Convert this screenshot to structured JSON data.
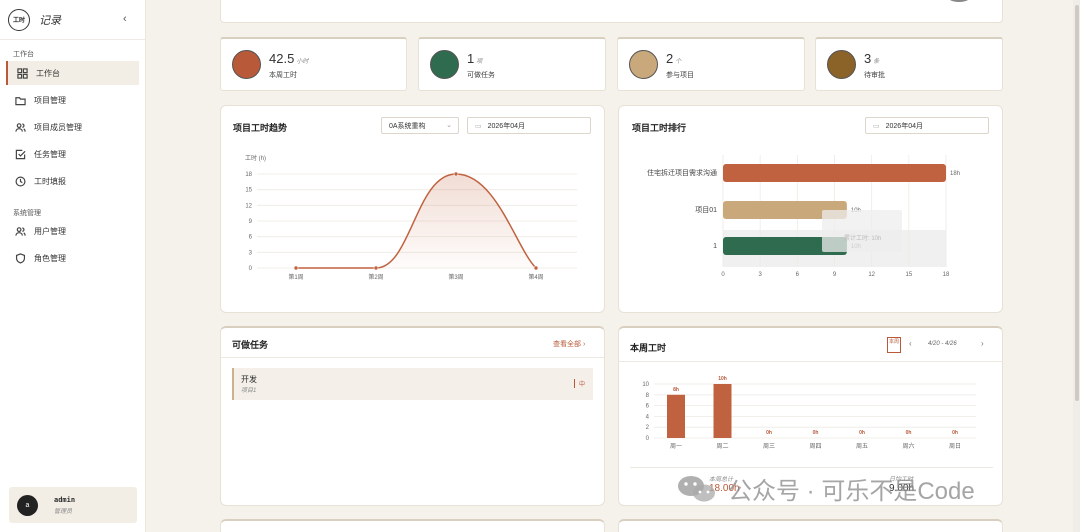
{
  "sidebar": {
    "logo_text": "工时",
    "title": "记录",
    "collapse_icon": "chevron-left-icon",
    "sections": [
      {
        "label": "工作台"
      },
      {
        "label": "系统管理"
      }
    ],
    "items": [
      {
        "label": "工作台",
        "icon": "grid-icon",
        "active": true
      },
      {
        "label": "项目管理",
        "icon": "folder-icon"
      },
      {
        "label": "项目成员管理",
        "icon": "users-icon"
      },
      {
        "label": "任务管理",
        "icon": "checkbox-icon"
      },
      {
        "label": "工时填报",
        "icon": "clock-icon"
      },
      {
        "label": "用户管理",
        "icon": "users-icon"
      },
      {
        "label": "角色管理",
        "icon": "shield-icon"
      }
    ],
    "user": {
      "avatar": "a",
      "name": "admin",
      "role": "管理员"
    }
  },
  "stats": [
    {
      "value": "42.5",
      "unit": "小时",
      "label": "本周工时",
      "color": "#b85a3a"
    },
    {
      "value": "1",
      "unit": "项",
      "label": "可做任务",
      "color": "#2f6b4f"
    },
    {
      "value": "2",
      "unit": "个",
      "label": "参与项目",
      "color": "#c9a87c"
    },
    {
      "value": "3",
      "unit": "条",
      "label": "待审批",
      "color": "#8b6228"
    }
  ],
  "trend": {
    "title": "项目工时趋势",
    "project_select": "0A系统重构",
    "month": "2026年04月",
    "chart_data": {
      "type": "line",
      "ylabel": "工时 (h)",
      "categories": [
        "第1周",
        "第2周",
        "第3周",
        "第4周"
      ],
      "values": [
        0,
        0,
        18,
        0
      ],
      "ylim": [
        0,
        18
      ],
      "yticks": [
        "0",
        "3",
        "6",
        "9",
        "12",
        "15",
        "18"
      ],
      "color": "#c0623f"
    }
  },
  "ranking": {
    "title": "项目工时排行",
    "month": "2026年04月",
    "tooltip": "累计工时: 10h",
    "chart_data": {
      "type": "bar",
      "categories": [
        "住宅拆迁项目需求沟通",
        "项目01",
        "1"
      ],
      "values": [
        18,
        10,
        10
      ],
      "value_labels": [
        "18h",
        "10h",
        "10h"
      ],
      "xlim": [
        0,
        18
      ],
      "xticks": [
        "0",
        "3",
        "6",
        "9",
        "12",
        "15",
        "18"
      ],
      "colors": [
        "#c0623f",
        "#c9a87c",
        "#2f6b4f"
      ]
    }
  },
  "tasks": {
    "title": "可做任务",
    "view_all": "查看全部 ›",
    "items": [
      {
        "name": "开发",
        "project": "项目1",
        "priority": "中"
      }
    ]
  },
  "week": {
    "title": "本周工时",
    "badge": "本周",
    "range": "4/20 - 4/26",
    "chart_data": {
      "type": "bar",
      "categories": [
        "周一",
        "周二",
        "周三",
        "周四",
        "周五",
        "周六",
        "周日"
      ],
      "values": [
        8,
        10,
        0,
        0,
        0,
        0,
        0
      ],
      "value_labels": [
        "8h",
        "10h",
        "0h",
        "0h",
        "0h",
        "0h",
        "0h"
      ],
      "ylim": [
        0,
        10
      ],
      "yticks": [
        "0",
        "2",
        "4",
        "6",
        "8",
        "10"
      ],
      "color": "#c0623f"
    },
    "summary_left": {
      "label": "本周总计",
      "value": "18.00h"
    },
    "summary_right": {
      "label": "日均工时",
      "value": "9.00h"
    }
  },
  "watermark": "公众号 · 可乐不是Code"
}
